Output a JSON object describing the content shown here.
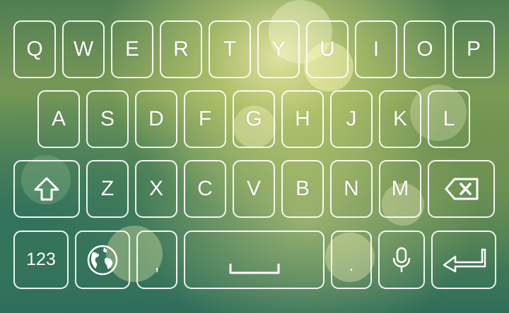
{
  "keyboard": {
    "row1": [
      "Q",
      "W",
      "E",
      "R",
      "T",
      "Y",
      "U",
      "I",
      "O",
      "P"
    ],
    "row2": [
      "A",
      "S",
      "D",
      "F",
      "G",
      "H",
      "J",
      "K",
      "L"
    ],
    "row3": [
      "Z",
      "X",
      "C",
      "V",
      "B",
      "N",
      "M"
    ],
    "bottom": {
      "numbers_label": "123",
      "comma_label": ",",
      "period_label": "."
    },
    "icons": {
      "shift": "shift-arrow-icon",
      "backspace": "backspace-icon",
      "globe": "globe-icon",
      "space": "space-bar-icon",
      "microphone": "microphone-icon",
      "enter": "enter-icon"
    },
    "colors": {
      "key_border": "#ffffff",
      "key_text": "#ffffff"
    }
  }
}
